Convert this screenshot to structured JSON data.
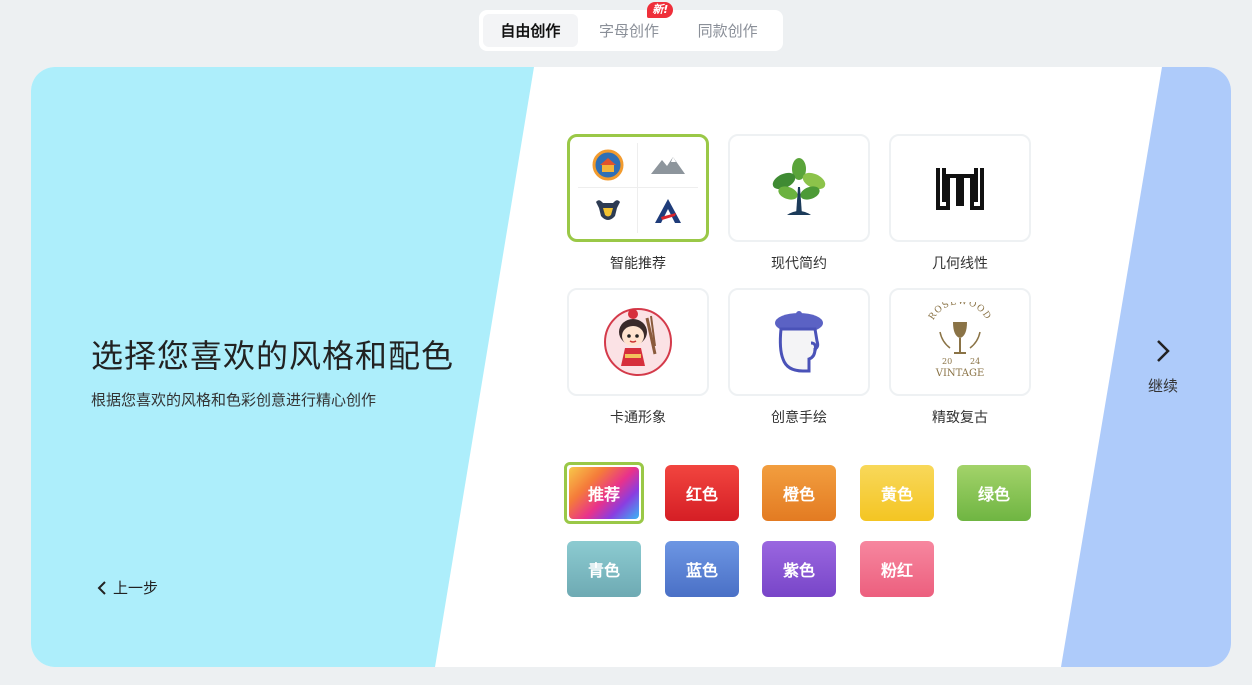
{
  "tabs": [
    {
      "label": "自由创作",
      "active": true
    },
    {
      "label": "字母创作",
      "badge": "新!"
    },
    {
      "label": "同款创作"
    }
  ],
  "left": {
    "headline": "选择您喜欢的风格和配色",
    "subline": "根据您喜欢的风格和色彩创意进行精心创作",
    "prev_label": "上一步"
  },
  "next_label": "继续",
  "styles": [
    {
      "label": "智能推荐",
      "icon": "recommend-collage-icon",
      "selected": true
    },
    {
      "label": "现代简约",
      "icon": "tree-logo-icon"
    },
    {
      "label": "几何线性",
      "icon": "geometric-w-logo-icon"
    },
    {
      "label": "卡通形象",
      "icon": "cartoon-girl-icon"
    },
    {
      "label": "创意手绘",
      "icon": "hand-drawn-face-icon"
    },
    {
      "label": "精致复古",
      "icon": "vintage-wine-badge-icon",
      "badge_text": [
        "ROSEWOOD",
        "20",
        "24",
        "VINTAGE"
      ]
    }
  ],
  "colors": [
    {
      "label": "推荐",
      "selected": true
    },
    {
      "label": "红色",
      "color": "#e0262d"
    },
    {
      "label": "橙色",
      "color": "#e98a2a"
    },
    {
      "label": "黄色",
      "color": "#f6cd2b"
    },
    {
      "label": "绿色",
      "color": "#80c04f"
    },
    {
      "label": "青色",
      "color": "#7dbcc3"
    },
    {
      "label": "蓝色",
      "color": "#5b84d6"
    },
    {
      "label": "紫色",
      "color": "#8856d3"
    },
    {
      "label": "粉红",
      "color": "#f06c88"
    }
  ],
  "accent": "#9ac847"
}
